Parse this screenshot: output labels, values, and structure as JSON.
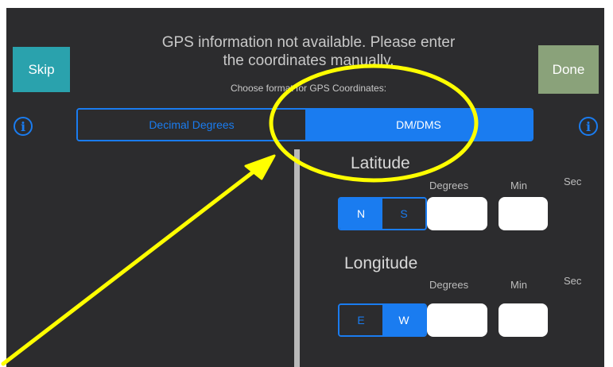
{
  "header": {
    "skip_label": "Skip",
    "done_label": "Done",
    "message_line1": "GPS information not available. Please enter",
    "message_line2": "the coordinates manually.",
    "subtitle": "Choose format for GPS Coordinates:"
  },
  "format_toggle": {
    "options": [
      "Decimal Degrees",
      "DM/DMS"
    ],
    "selected": "DM/DMS"
  },
  "icons": {
    "left_info": "info-icon",
    "right_info": "info-icon",
    "info_glyph": "i"
  },
  "latitude": {
    "title": "Latitude",
    "labels": {
      "degrees": "Degrees",
      "min": "Min",
      "sec": "Sec"
    },
    "hemisphere": {
      "options": [
        "N",
        "S"
      ],
      "selected": "N"
    },
    "degrees_value": "",
    "min_value": ""
  },
  "longitude": {
    "title": "Longitude",
    "labels": {
      "degrees": "Degrees",
      "min": "Min",
      "sec": "Sec"
    },
    "hemisphere": {
      "options": [
        "E",
        "W"
      ],
      "selected": "W"
    },
    "degrees_value": "",
    "min_value": ""
  },
  "colors": {
    "background": "#2c2c2e",
    "accent_blue": "#1a7cf0",
    "skip_teal": "#2aa2ad",
    "done_green": "#8aa27a",
    "annotation_yellow": "#ffff00"
  }
}
